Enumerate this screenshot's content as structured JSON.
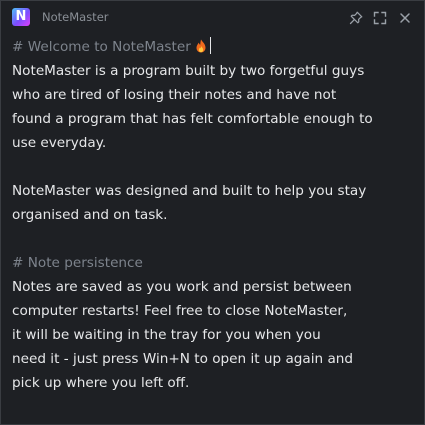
{
  "titlebar": {
    "app_title": "NoteMaster",
    "logo_letter": "N",
    "icons": [
      "pin-icon",
      "maximize-icon",
      "close-icon"
    ]
  },
  "note": {
    "lines": [
      {
        "text": "# Welcome to NoteMaster",
        "kind": "heading",
        "emoji": "fire-icon",
        "caret": true
      },
      {
        "text": "NoteMaster is a program built by two forgetful guys",
        "kind": "body"
      },
      {
        "text": "who are tired of losing their notes and have not",
        "kind": "body"
      },
      {
        "text": "found a program that has felt comfortable enough to",
        "kind": "body"
      },
      {
        "text": "use everyday.",
        "kind": "body"
      },
      {
        "text": "",
        "kind": "blank"
      },
      {
        "text": "NoteMaster was designed and built to help you stay",
        "kind": "body"
      },
      {
        "text": "organised and on task.",
        "kind": "body"
      },
      {
        "text": "",
        "kind": "blank"
      },
      {
        "text": "# Note persistence",
        "kind": "heading"
      },
      {
        "text": "Notes are saved as you work and persist between",
        "kind": "body"
      },
      {
        "text": "computer restarts! Feel free to close NoteMaster,",
        "kind": "body"
      },
      {
        "text": "it will be waiting in the tray for you when you",
        "kind": "body"
      },
      {
        "text": "need it - just press Win+N to open it up again and",
        "kind": "body"
      },
      {
        "text": "pick up where you left off.",
        "kind": "body"
      }
    ]
  },
  "colors": {
    "background": "#1e2024",
    "text": "#e6e7e9",
    "heading": "#7d838c",
    "title": "#8a8f96"
  }
}
